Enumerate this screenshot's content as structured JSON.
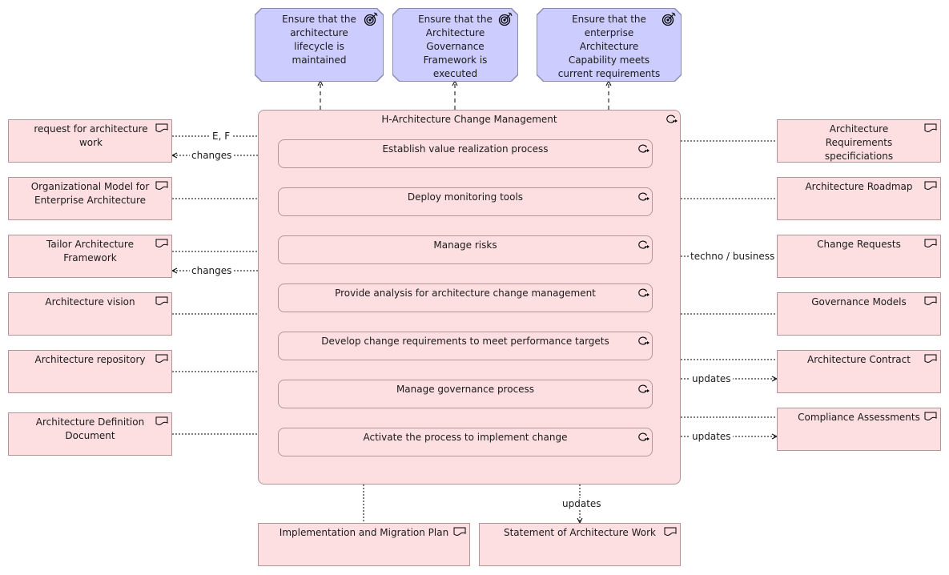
{
  "goals": [
    {
      "label": "Ensure that the architecture lifecycle is maintained"
    },
    {
      "label": "Ensure that the Architecture Governance Framework is executed"
    },
    {
      "label": "Ensure that the enterprise Architecture Capability meets current requirements"
    }
  ],
  "container": {
    "title": "H-Architecture Change Management",
    "processes": [
      {
        "label": "Establish value realization process"
      },
      {
        "label": "Deploy monitoring tools"
      },
      {
        "label": "Manage risks"
      },
      {
        "label": "Provide analysis for architecture change management"
      },
      {
        "label": "Develop change requirements to meet performance targets"
      },
      {
        "label": "Manage governance process"
      },
      {
        "label": "Activate the process to implement change"
      }
    ]
  },
  "left_artifacts": [
    {
      "label": "request for architecture work"
    },
    {
      "label": "Organizational Model for Enterprise Architecture"
    },
    {
      "label": "Tailor Architecture Framework"
    },
    {
      "label": "Architecture vision"
    },
    {
      "label": "Architecture repository"
    },
    {
      "label": "Architecture Definition Document"
    }
  ],
  "right_artifacts": [
    {
      "label": "Architecture Requirements specificiations"
    },
    {
      "label": "Architecture Roadmap"
    },
    {
      "label": "Change Requests"
    },
    {
      "label": "Governance Models"
    },
    {
      "label": "Architecture Contract"
    },
    {
      "label": "Compliance Assessments"
    }
  ],
  "bottom_artifacts": [
    {
      "label": "Implementation and Migration Plan"
    },
    {
      "label": "Statement of Architecture Work"
    }
  ],
  "relation_labels": {
    "ef": "E, F",
    "changes_1": "changes",
    "changes_2": "changes",
    "techno_business": "techno / business",
    "updates_contract": "updates",
    "updates_compliance": "updates",
    "updates_statement": "updates"
  },
  "colors": {
    "goal_fill": "#ccccff",
    "artifact_fill": "#fddfe1",
    "border": "#b39598"
  }
}
